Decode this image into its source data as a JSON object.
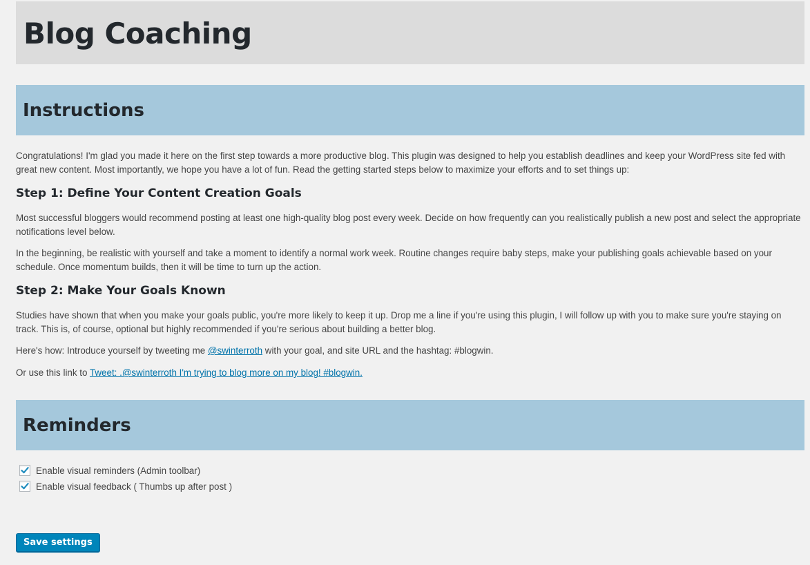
{
  "page": {
    "title": "Blog Coaching"
  },
  "instructions": {
    "heading": "Instructions",
    "intro": "Congratulations! I'm glad you made it here on the first step towards a more productive blog. This plugin was designed to help you establish deadlines and keep your WordPress site fed with great new content. Most importantly, we hope you have a lot of fun. Read the getting started steps below to maximize your efforts and to set things up:",
    "step1": {
      "title": "Step 1: Define Your Content Creation Goals",
      "para1": "Most successful bloggers would recommend posting at least one high-quality blog post every week. Decide on how frequently can you realistically publish a new post and select the appropriate notifications level below.",
      "para2": "In the beginning, be realistic with yourself and take a moment to identify a normal work week. Routine changes require baby steps, make your publishing goals achievable based on your schedule. Once momentum builds, then it will be time to turn up the action."
    },
    "step2": {
      "title": "Step 2: Make Your Goals Known",
      "para1": "Studies have shown that when you make your goals public, you're more likely to keep it up. Drop me a line if you're using this plugin, I will follow up with you to make sure you're staying on track. This is, of course, optional but highly recommended if you're serious about building a better blog.",
      "howto_prefix": "Here's how: Introduce yourself by tweeting me ",
      "howto_link": "@swinterroth",
      "howto_suffix": " with your goal, and site URL and the hashtag: #blogwin.",
      "link_prefix": "Or use this link to ",
      "tweet_link": "Tweet: .@swinterroth I'm trying to blog more on my blog! #blogwin."
    }
  },
  "reminders": {
    "heading": "Reminders",
    "options": [
      {
        "label": "Enable visual reminders (Admin toolbar)",
        "checked": true
      },
      {
        "label": "Enable visual feedback ( Thumbs up after post )",
        "checked": true
      }
    ]
  },
  "actions": {
    "save_label": "Save settings"
  },
  "colors": {
    "background": "#f1f1f1",
    "title_bar": "#dcdcdc",
    "section_bar": "#a5c8dc",
    "link": "#0073aa",
    "primary_button": "#0085ba",
    "check": "#1e8cbe"
  }
}
